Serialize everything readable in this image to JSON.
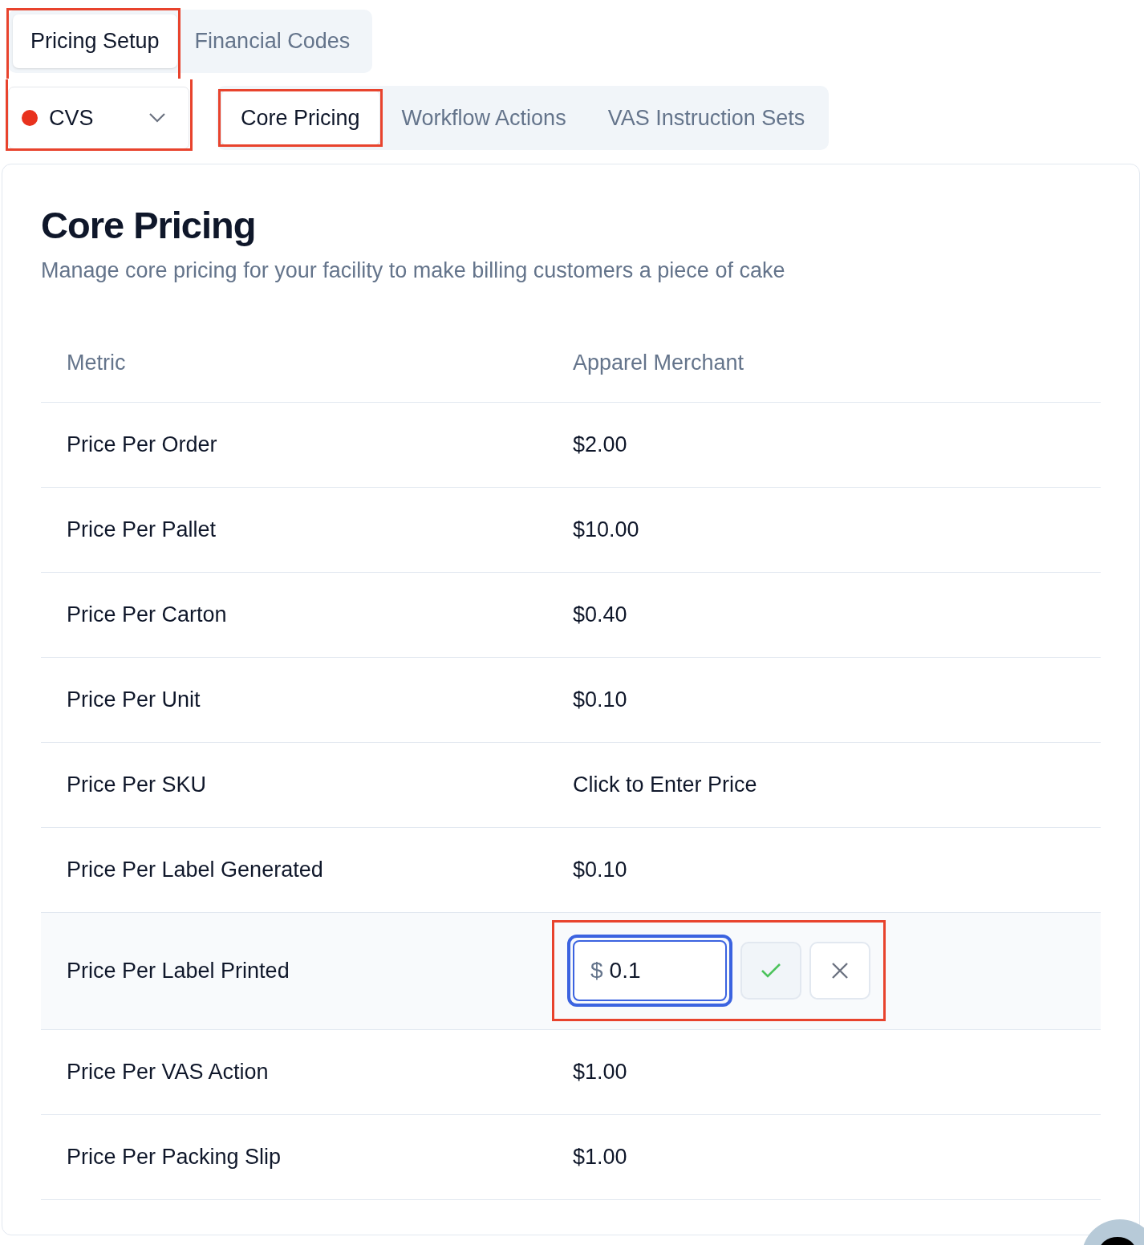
{
  "primary_tabs": [
    {
      "label": "Pricing Setup",
      "selected": true,
      "highlighted": true
    },
    {
      "label": "Financial Codes",
      "selected": false,
      "highlighted": false
    }
  ],
  "client_selector": {
    "value": "CVS",
    "color": "#e8321e",
    "highlighted": true
  },
  "secondary_tabs": [
    {
      "label": "Core Pricing",
      "selected": true,
      "highlighted": true
    },
    {
      "label": "Workflow Actions",
      "selected": false,
      "highlighted": false
    },
    {
      "label": "VAS Instruction Sets",
      "selected": false,
      "highlighted": false
    }
  ],
  "card": {
    "title": "Core Pricing",
    "subtitle": "Manage core pricing for your facility to make billing customers a piece of cake"
  },
  "table": {
    "columns": [
      "Metric",
      "Apparel Merchant"
    ],
    "rows": [
      {
        "metric": "Price Per Order",
        "editing": false,
        "price": "$2.00"
      },
      {
        "metric": "Price Per Pallet",
        "editing": false,
        "price": "$10.00"
      },
      {
        "metric": "Price Per Carton",
        "editing": false,
        "price": "$0.40"
      },
      {
        "metric": "Price Per Unit",
        "editing": false,
        "price": "$0.10"
      },
      {
        "metric": "Price Per SKU",
        "editing": false,
        "price": "Click to Enter Price"
      },
      {
        "metric": "Price Per Label Generated",
        "editing": false,
        "price": "$0.10"
      },
      {
        "metric": "Price Per Label Printed",
        "editing": true,
        "currency": "$",
        "value": "0.1",
        "highlighted": true
      },
      {
        "metric": "Price Per VAS Action",
        "editing": false,
        "price": "$1.00"
      },
      {
        "metric": "Price Per Packing Slip",
        "editing": false,
        "price": "$1.00"
      }
    ]
  }
}
